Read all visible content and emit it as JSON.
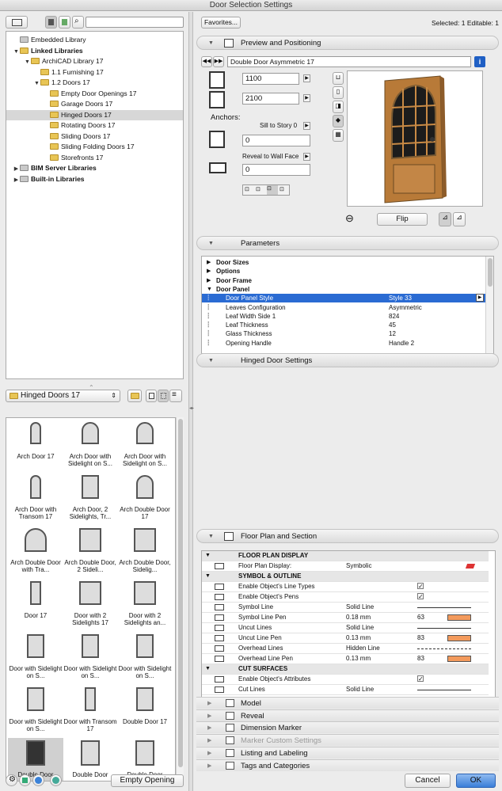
{
  "window": {
    "title": "Door Selection Settings"
  },
  "header": {
    "favorites_label": "Favorites...",
    "selection_status": "Selected: 1 Editable: 1"
  },
  "library_tree": [
    {
      "label": "Embedded Library",
      "bold": false
    },
    {
      "label": "Linked Libraries",
      "bold": true
    },
    {
      "label": "ArchiCAD Library 17",
      "bold": false
    },
    {
      "label": "1.1 Furnishing 17",
      "bold": false
    },
    {
      "label": "1.2 Doors 17",
      "bold": false
    },
    {
      "label": "Empty Door Openings 17",
      "bold": false
    },
    {
      "label": "Garage Doors 17",
      "bold": false
    },
    {
      "label": "Hinged Doors 17",
      "bold": false,
      "selected": true
    },
    {
      "label": "Rotating Doors 17",
      "bold": false
    },
    {
      "label": "Sliding Doors 17",
      "bold": false
    },
    {
      "label": "Sliding Folding Doors 17",
      "bold": false
    },
    {
      "label": "Storefronts 17",
      "bold": false
    },
    {
      "label": "BIM Server Libraries",
      "bold": true
    },
    {
      "label": "Built-in Libraries",
      "bold": true
    }
  ],
  "folder_select": {
    "value": "Hinged Doors 17"
  },
  "thumbnails": [
    {
      "label": "Arch Door 17"
    },
    {
      "label": "Arch Door with Sidelight on S..."
    },
    {
      "label": "Arch Door with Sidelight on S..."
    },
    {
      "label": "Arch Door with Transom 17"
    },
    {
      "label": "Arch Door, 2 Sidelights, Tr..."
    },
    {
      "label": "Arch Double Door 17"
    },
    {
      "label": "Arch Double Door with Tra..."
    },
    {
      "label": "Arch Double Door, 2 Sideli..."
    },
    {
      "label": "Arch Double Door, Sidelig..."
    },
    {
      "label": "Door 17"
    },
    {
      "label": "Door with 2 Sidelights 17"
    },
    {
      "label": "Door with 2 Sidelights an..."
    },
    {
      "label": "Door with Sidelight on S..."
    },
    {
      "label": "Door with Sidelight on S..."
    },
    {
      "label": "Door with Sidelight on S..."
    },
    {
      "label": "Door with Sidelight on S..."
    },
    {
      "label": "Door with Transom 17"
    },
    {
      "label": "Double Door 17"
    },
    {
      "label": "Double Door"
    },
    {
      "label": "Double Door"
    },
    {
      "label": "Double Door"
    }
  ],
  "empty_opening_label": "Empty Opening",
  "preview": {
    "section_title": "Preview and Positioning",
    "object_name": "Double Door Asymmetric 17",
    "width": "1100",
    "height": "2100",
    "anchors_label": "Anchors:",
    "sill_label": "Sill to Story 0",
    "sill_value": "0",
    "reveal_label": "Reveal to Wall Face",
    "reveal_value": "0",
    "flip_label": "Flip"
  },
  "parameters": {
    "section_title": "Parameters",
    "rows": [
      {
        "name": "Door Sizes",
        "value": "",
        "bold": true,
        "group": true
      },
      {
        "name": "Options",
        "value": "",
        "bold": true,
        "group": true
      },
      {
        "name": "Door Frame",
        "value": "",
        "bold": true,
        "group": true
      },
      {
        "name": "Door Panel",
        "value": "",
        "bold": true,
        "group": true,
        "open": true
      },
      {
        "name": "Door Panel Style",
        "value": "Style 33",
        "selected": true
      },
      {
        "name": "Leaves Configuration",
        "value": "Asymmetric"
      },
      {
        "name": "Leaf Width Side 1",
        "value": "824"
      },
      {
        "name": "Leaf Thickness",
        "value": "45"
      },
      {
        "name": "Glass Thickness",
        "value": "12"
      },
      {
        "name": "Opening Handle",
        "value": "Handle 2"
      }
    ]
  },
  "hinged_section_title": "Hinged Door Settings",
  "floor_plan": {
    "section_title": "Floor Plan and Section",
    "rows": [
      {
        "kind": "hdr",
        "name": "FLOOR PLAN DISPLAY"
      },
      {
        "kind": "val",
        "name": "Floor Plan Display:",
        "value": "Symbolic"
      },
      {
        "kind": "hdr",
        "name": "SYMBOL & OUTLINE"
      },
      {
        "kind": "chk",
        "name": "Enable Object's Line Types",
        "value": "✓"
      },
      {
        "kind": "chk",
        "name": "Enable Object's Pens",
        "value": "✓"
      },
      {
        "kind": "line",
        "name": "Symbol Line",
        "value": "Solid Line"
      },
      {
        "kind": "pen",
        "name": "Symbol Line Pen",
        "value": "0.18 mm",
        "num": "63"
      },
      {
        "kind": "line",
        "name": "Uncut Lines",
        "value": "Solid Line"
      },
      {
        "kind": "pen",
        "name": "Uncut Line Pen",
        "value": "0.13 mm",
        "num": "83"
      },
      {
        "kind": "dash",
        "name": "Overhead Lines",
        "value": "Hidden Line"
      },
      {
        "kind": "pen",
        "name": "Overhead Line Pen",
        "value": "0.13 mm",
        "num": "83"
      },
      {
        "kind": "hdr",
        "name": "CUT SURFACES"
      },
      {
        "kind": "chk",
        "name": "Enable Object's Attributes",
        "value": "✓"
      },
      {
        "kind": "line",
        "name": "Cut Lines",
        "value": "Solid Line"
      }
    ]
  },
  "collapsed_sections": [
    {
      "label": "Model",
      "dim": false
    },
    {
      "label": "Reveal",
      "dim": false
    },
    {
      "label": "Dimension Marker",
      "dim": false
    },
    {
      "label": "Marker Custom Settings",
      "dim": true
    },
    {
      "label": "Listing and Labeling",
      "dim": false
    },
    {
      "label": "Tags and Categories",
      "dim": false
    }
  ],
  "footer": {
    "cancel_label": "Cancel",
    "ok_label": "OK"
  },
  "colors": {
    "selection_blue": "#2a6bd3",
    "pen_orange": "#f39a5c",
    "door_wood": "#c98a45"
  }
}
